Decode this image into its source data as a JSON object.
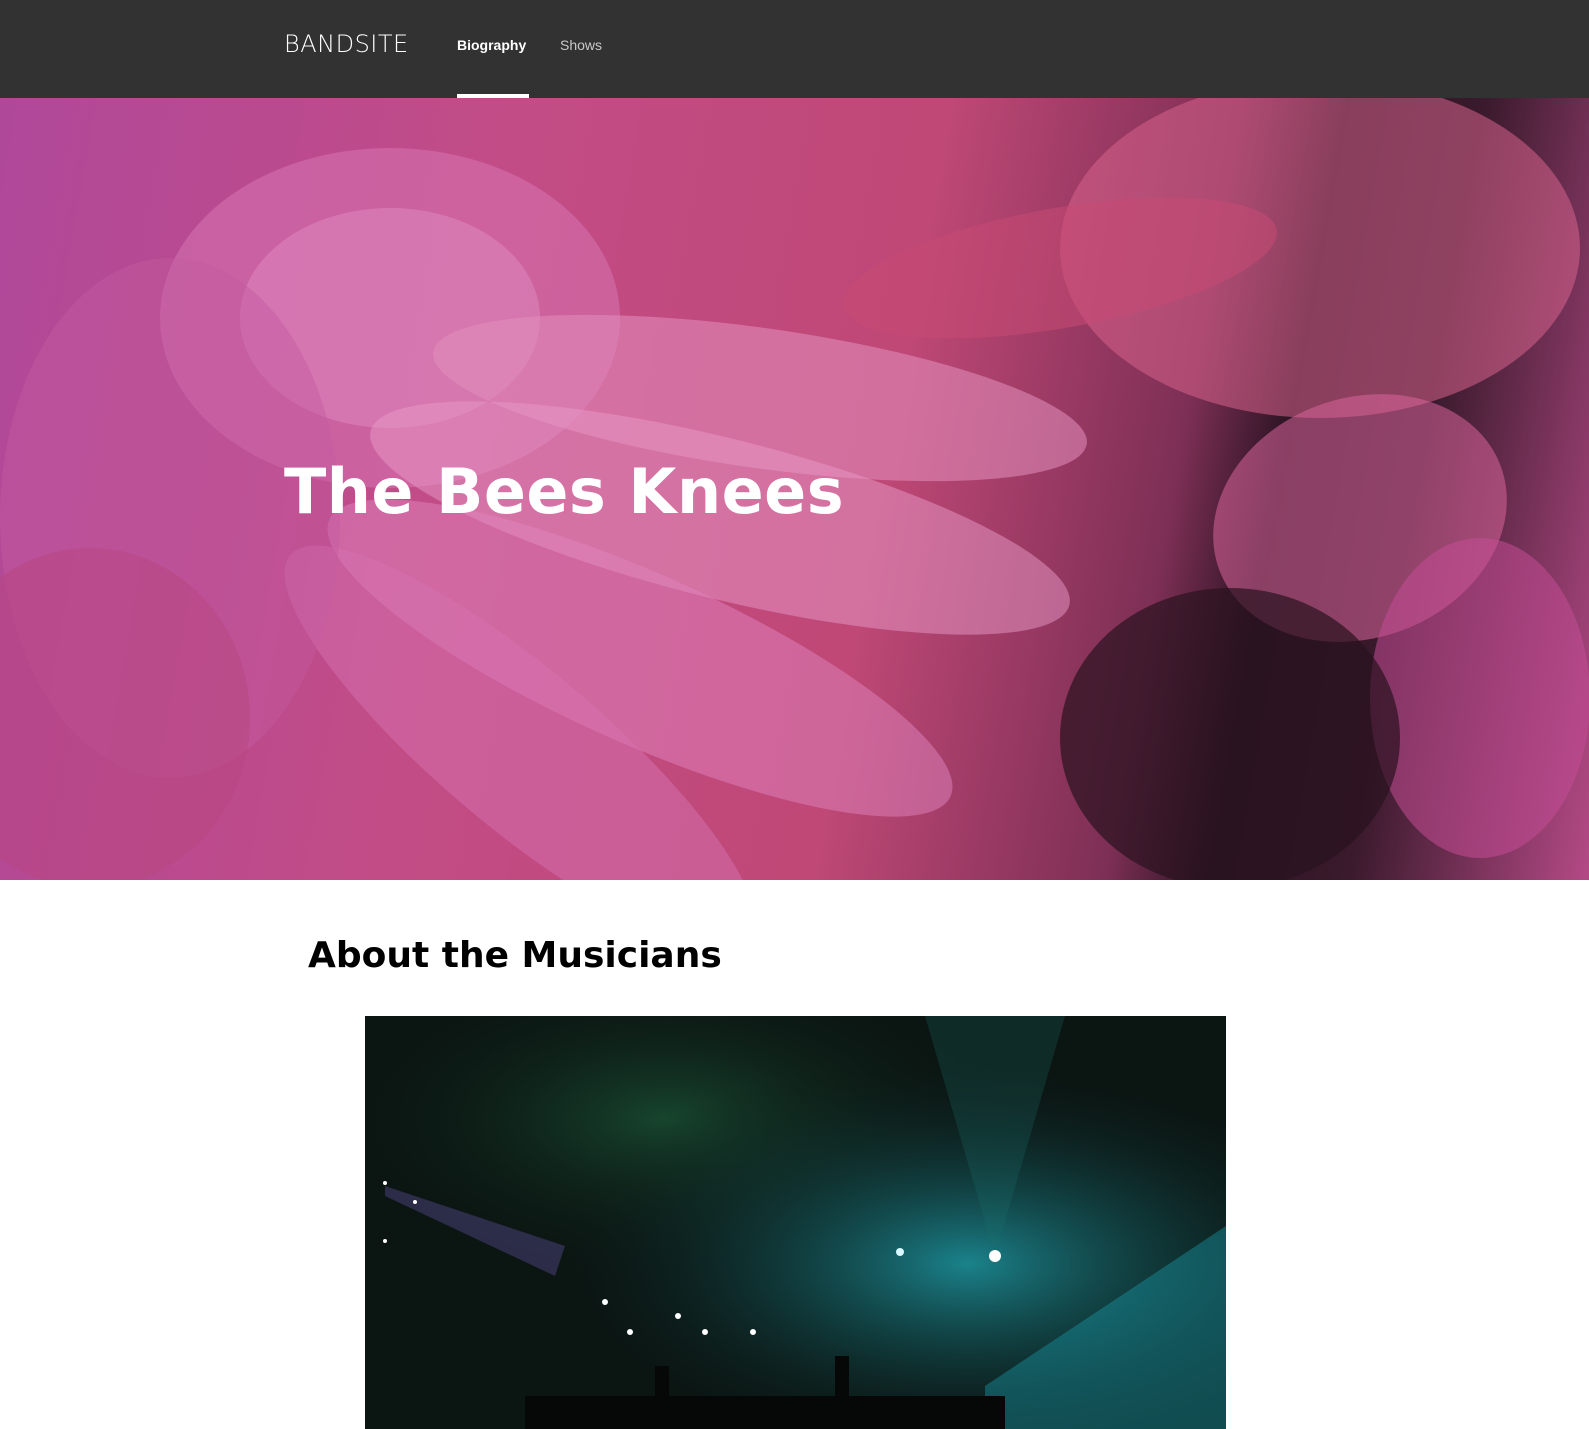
{
  "header": {
    "logo": "BANDSITE",
    "nav": [
      {
        "label": "Biography",
        "active": true
      },
      {
        "label": "Shows",
        "active": false
      }
    ]
  },
  "hero": {
    "title": "The Bees Knees"
  },
  "about": {
    "title": "About the Musicians"
  },
  "colors": {
    "header_bg": "#323232",
    "hero_accent": "#c24c86",
    "text_dark": "#000000"
  }
}
